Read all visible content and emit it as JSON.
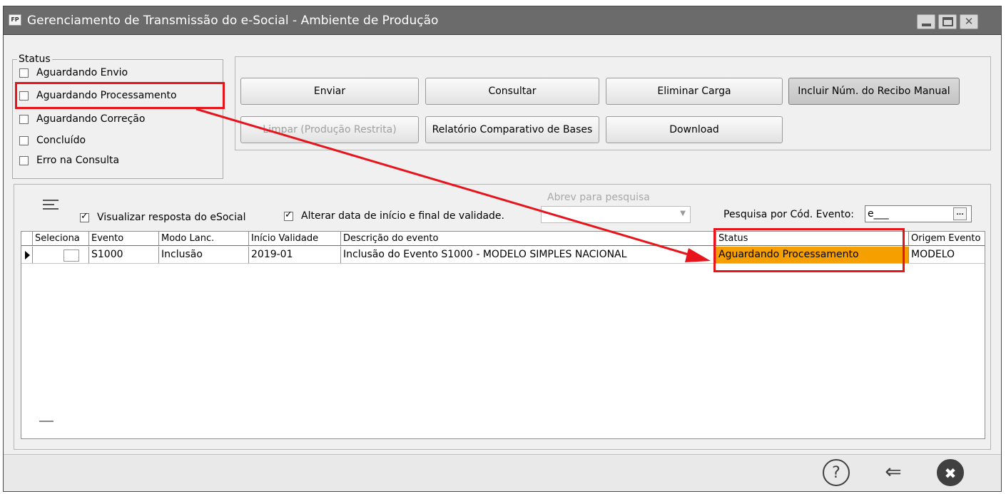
{
  "window": {
    "icon_text": "FP",
    "title": "Gerenciamento de Transmissão do e-Social - Ambiente de Produção"
  },
  "status_group": {
    "legend": "Status",
    "items": [
      {
        "label": "Aguardando Envio",
        "checked": false
      },
      {
        "label": "Aguardando Processamento",
        "checked": false
      },
      {
        "label": "Aguardando Correção",
        "checked": false
      },
      {
        "label": "Concluído",
        "checked": false
      },
      {
        "label": "Erro na Consulta",
        "checked": false
      }
    ]
  },
  "buttons": {
    "enviar": "Enviar",
    "consultar": "Consultar",
    "eliminar_carga": "Eliminar Carga",
    "incluir_recibo": "Incluir Núm. do Recibo Manual",
    "limpar": "Limpar (Produção Restrita)",
    "relatorio": "Relatório Comparativo de Bases",
    "download": "Download"
  },
  "toolbar": {
    "visualizar_label": "Visualizar resposta do eSocial",
    "visualizar_checked": true,
    "alterar_label": "Alterar data de início e final de validade.",
    "alterar_checked": true,
    "abrev_label": "Abrev para pesquisa",
    "abrev_value": "",
    "pesquisa_label": "Pesquisa por Cód. Evento:",
    "pesquisa_value": "e___",
    "pesquisa_btn": "..."
  },
  "grid": {
    "columns": [
      "Seleciona",
      "Evento",
      "Modo Lanc.",
      "Início Validade",
      "Descrição do evento",
      "Status",
      "Origem Evento"
    ],
    "rows": [
      {
        "selected": false,
        "evento": "S1000",
        "modo": "Inclusão",
        "inicio": "2019-01",
        "descricao": "Inclusão do Evento S1000 - MODELO SIMPLES NACIONAL",
        "status": "Aguardando Processamento",
        "origem": "MODELO"
      }
    ]
  },
  "bottom": {
    "help": "?",
    "back": "⇐",
    "exit": "✖"
  },
  "colors": {
    "annotation": "#e8141b",
    "status_highlight": "#f5a000",
    "titlebar": "#6b6b6b"
  }
}
